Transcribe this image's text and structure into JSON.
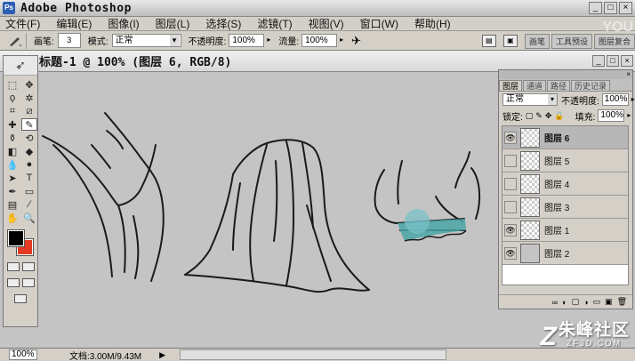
{
  "window": {
    "title": "Adobe Photoshop",
    "app_icon": "Ps",
    "min": "_",
    "max": "□",
    "close": "×"
  },
  "menu": [
    "文件(F)",
    "编辑(E)",
    "图像(I)",
    "图层(L)",
    "选择(S)",
    "滤镜(T)",
    "视图(V)",
    "窗口(W)",
    "帮助(H)"
  ],
  "options": {
    "brush_label": "画笔:",
    "brush_size": "3",
    "mode_label": "模式:",
    "mode_value": "正常",
    "opacity_label": "不透明度:",
    "opacity_value": "100%",
    "flow_label": "流量:",
    "flow_value": "100%",
    "well_tabs": [
      "画笔",
      "工具预设",
      "图层复合"
    ]
  },
  "document": {
    "title": "标题-1 @ 100% (图层 6, RGB/8)"
  },
  "toolbox": {
    "tools": [
      "marquee-icon",
      "move-icon",
      "lasso-icon",
      "magic-wand-icon",
      "crop-icon",
      "slice-icon",
      "healing-icon",
      "brush-icon",
      "stamp-icon",
      "history-brush-icon",
      "eraser-icon",
      "bucket-icon",
      "blur-icon",
      "dodge-icon",
      "path-select-icon",
      "type-icon",
      "pen-icon",
      "shape-icon",
      "notes-icon",
      "eyedropper-icon",
      "hand-icon",
      "zoom-icon"
    ],
    "glyphs": [
      "⬚",
      "✥",
      "ϙ",
      "✲",
      "⌗",
      "⧄",
      "✚",
      "✎",
      "⚱",
      "⟲",
      "◧",
      "◆",
      "💧",
      "●",
      "➤",
      "T",
      "✒",
      "▭",
      "▤",
      "⁄",
      "✋",
      "🔍"
    ],
    "fg_color": "#000000",
    "bg_color": "#e33a23"
  },
  "layers_panel": {
    "tabs": [
      "图层",
      "通道",
      "路径",
      "历史记录"
    ],
    "blend_mode": "正常",
    "opacity_label": "不透明度:",
    "opacity_value": "100%",
    "lock_label": "锁定:",
    "fill_label": "填充:",
    "fill_value": "100%",
    "layers": [
      {
        "name": "图层 6",
        "visible": true,
        "active": true
      },
      {
        "name": "图层 5",
        "visible": false,
        "active": false
      },
      {
        "name": "图层 4",
        "visible": false,
        "active": false
      },
      {
        "name": "图层 3",
        "visible": false,
        "active": false
      },
      {
        "name": "图层 1",
        "visible": true,
        "active": false
      },
      {
        "name": "图层 2",
        "visible": true,
        "active": false
      }
    ],
    "footer_icons": [
      "∞",
      "◐",
      "▢",
      "◑",
      "▭",
      "▣",
      "🗑"
    ]
  },
  "status": {
    "zoom": "100%",
    "doc_info": "文档:3.00M/9.43M",
    "arrow": "▶"
  },
  "watermark": {
    "logo": "Z",
    "name": "朱峰社区",
    "domain": "ZF3D.COM",
    "corner": "YOU"
  }
}
